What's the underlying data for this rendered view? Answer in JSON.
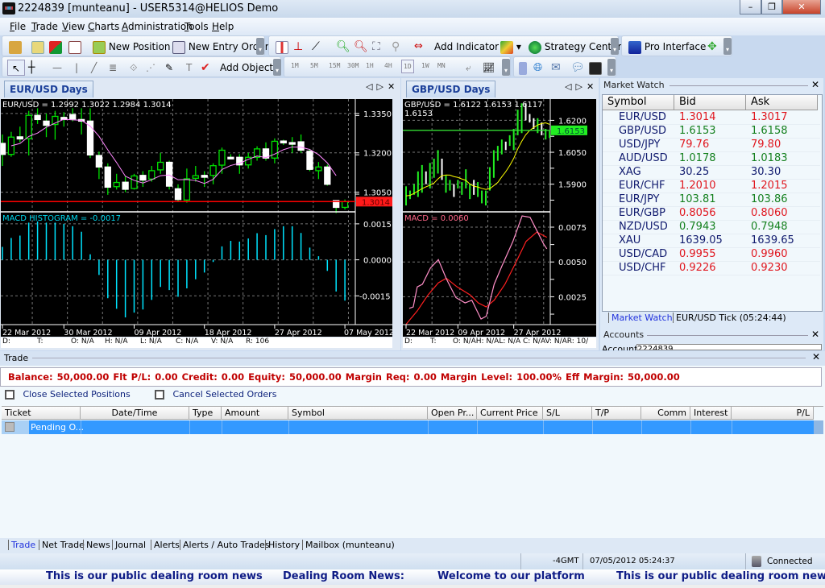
{
  "window": {
    "title": "2224839 [munteanu] - USER5314@HELIOS Demo",
    "minimize": "–",
    "maximize": "❐",
    "close": "✕"
  },
  "menu": [
    "File",
    "Trade",
    "View",
    "Charts",
    "Administration",
    "Tools",
    "Help"
  ],
  "toolbar": {
    "new_position": "New Position",
    "new_entry_order": "New Entry Order",
    "add_indicator": "Add Indicator",
    "strategy_center": "Strategy Center",
    "pro_interface": "Pro Interface",
    "add_object": "Add Object",
    "timeframes": [
      "1M",
      "5M",
      "15M",
      "30M",
      "1H",
      "4H",
      "1D",
      "1W",
      "MN"
    ],
    "active_timeframe": "1D"
  },
  "charts": [
    {
      "tab": "EUR/USD Days",
      "symbol": "EUR/USD",
      "ohlc_text": "EUR/USD = 1.2992  1.3022  1.2984  1.3014",
      "last_price": "1.3014",
      "price_ticks": [
        "1.3350",
        "1.3200",
        "1.3050"
      ],
      "indicator_label": "MACD HISTOGRAM = -0.0017",
      "indicator_ticks": [
        "0.0015",
        "0.0000",
        "-0.0015"
      ],
      "date_ticks": [
        {
          "label": "22 Mar 2012",
          "i": 0
        },
        {
          "label": "30 Mar 2012",
          "i": 7
        },
        {
          "label": "09 Apr 2012",
          "i": 15
        },
        {
          "label": "18 Apr 2012",
          "i": 23
        },
        {
          "label": "27 Apr 2012",
          "i": 31
        },
        {
          "label": "07 May 2012",
          "i": 39
        }
      ],
      "info": {
        "d": "D:",
        "t": "T:",
        "o": "O: N/A",
        "h": "H: N/A",
        "l": "L: N/A",
        "c": "C: N/A",
        "v": "V: N/A",
        "r": "R: 106"
      }
    },
    {
      "tab": "GBP/USD Days",
      "symbol": "GBP/USD",
      "ohlc_text": "GBP/USD = 1.6122  1.6153  1.6117",
      "ohlc_text2": "1.6153",
      "last_price": "1.6153",
      "price_ticks": [
        "1.6200",
        "1.6050",
        "1.5900"
      ],
      "indicator_label": "MACD = 0.0060",
      "indicator_ticks": [
        "0.0075",
        "0.0050",
        "0.0025"
      ],
      "date_ticks": [
        {
          "label": "22 Mar 2012",
          "i": 0
        },
        {
          "label": "09 Apr 2012",
          "i": 13
        },
        {
          "label": "27 Apr 2012",
          "i": 27
        }
      ],
      "info": {
        "d": "D:",
        "t": "T:",
        "rest": "O: N/AH: N/AL: N/A C: N/AV: N/AR: 10/"
      }
    }
  ],
  "chart_data": [
    {
      "type": "candlestick",
      "symbol": "EUR/USD",
      "ylim": [
        1.2975,
        1.3405
      ],
      "ticks": [
        1.335,
        1.32,
        1.305
      ],
      "last": 1.3014,
      "ohlc": [
        [
          1.3236,
          1.327,
          1.315,
          1.3194
        ],
        [
          1.3194,
          1.328,
          1.3185,
          1.326
        ],
        [
          1.3261,
          1.33,
          1.324,
          1.3253
        ],
        [
          1.3254,
          1.336,
          1.319,
          1.3343
        ],
        [
          1.3343,
          1.337,
          1.331,
          1.3327
        ],
        [
          1.3321,
          1.335,
          1.326,
          1.3305
        ],
        [
          1.3308,
          1.336,
          1.325,
          1.3339
        ],
        [
          1.3335,
          1.3355,
          1.33,
          1.3327
        ],
        [
          1.3346,
          1.337,
          1.332,
          1.3329
        ],
        [
          1.3327,
          1.337,
          1.327,
          1.3321
        ],
        [
          1.3321,
          1.337,
          1.318,
          1.3192
        ],
        [
          1.319,
          1.3205,
          1.31,
          1.3146
        ],
        [
          1.3146,
          1.316,
          1.304,
          1.3069
        ],
        [
          1.3071,
          1.312,
          1.306,
          1.3087
        ],
        [
          1.3088,
          1.311,
          1.305,
          1.3061
        ],
        [
          1.3064,
          1.312,
          1.306,
          1.3112
        ],
        [
          1.3114,
          1.313,
          1.307,
          1.3096
        ],
        [
          1.31,
          1.315,
          1.309,
          1.3132
        ],
        [
          1.3135,
          1.32,
          1.312,
          1.3164
        ],
        [
          1.3164,
          1.317,
          1.306,
          1.3073
        ],
        [
          1.3063,
          1.308,
          1.3015,
          1.3022
        ],
        [
          1.302,
          1.314,
          1.301,
          1.3101
        ],
        [
          1.3103,
          1.315,
          1.309,
          1.3113
        ],
        [
          1.3114,
          1.313,
          1.307,
          1.3107
        ],
        [
          1.3114,
          1.316,
          1.308,
          1.3151
        ],
        [
          1.3153,
          1.322,
          1.312,
          1.321
        ],
        [
          1.3183,
          1.3195,
          1.3175,
          1.3178
        ],
        [
          1.3183,
          1.3195,
          1.312,
          1.3154
        ],
        [
          1.3154,
          1.32,
          1.314,
          1.3183
        ],
        [
          1.3183,
          1.3225,
          1.317,
          1.3215
        ],
        [
          1.3215,
          1.324,
          1.317,
          1.318
        ],
        [
          1.318,
          1.3255,
          1.316,
          1.3244
        ],
        [
          1.3245,
          1.325,
          1.323,
          1.3238
        ],
        [
          1.3239,
          1.326,
          1.32,
          1.3235
        ],
        [
          1.3242,
          1.327,
          1.32,
          1.321
        ],
        [
          1.3206,
          1.3215,
          1.313,
          1.3137
        ],
        [
          1.3132,
          1.3165,
          1.31,
          1.3146
        ],
        [
          1.3146,
          1.3155,
          1.3075,
          1.308
        ],
        [
          1.3018,
          1.3018,
          1.297,
          1.2992
        ],
        [
          1.2992,
          1.3022,
          1.2984,
          1.3014
        ]
      ],
      "ma_color": "#ff88ff",
      "indicator": {
        "name": "MACD HISTOGRAM",
        "ylim": [
          -0.0027,
          0.002
        ],
        "ticks": [
          0.0015,
          0,
          -0.0015
        ],
        "color": "#00e5ff",
        "values": [
          0.00054,
          0.00091,
          0.00101,
          0.00155,
          0.0016,
          0.00155,
          0.00155,
          0.0015,
          0.0014,
          0.00117,
          0.00023,
          -0.00063,
          -0.0016,
          -0.00204,
          -0.0024,
          -0.0022,
          -0.00207,
          -0.00167,
          -0.00113,
          -0.00126,
          -0.00154,
          -0.00119,
          -0.00081,
          -0.00053,
          -9e-05,
          0.00056,
          0.00079,
          0.00076,
          0.00089,
          0.00111,
          0.00103,
          0.00128,
          0.0014,
          0.0014,
          0.00112,
          0.00051,
          0.00015,
          -0.00046,
          -0.00132,
          -0.0017
        ]
      }
    },
    {
      "type": "bars",
      "symbol": "GBP/USD",
      "ylim": [
        1.577,
        1.63
      ],
      "ticks": [
        1.62,
        1.605,
        1.59
      ],
      "last": 1.6153,
      "bars": [
        [
          1.58,
          1.589,
          "up"
        ],
        [
          1.583,
          1.587,
          "up"
        ],
        [
          1.585,
          1.59,
          "up"
        ],
        [
          1.584,
          1.596,
          "up"
        ],
        [
          1.586,
          1.599,
          "up"
        ],
        [
          1.59,
          1.596,
          "down"
        ],
        [
          1.588,
          1.6,
          "up"
        ],
        [
          1.593,
          1.602,
          "up"
        ],
        [
          1.595,
          1.606,
          "up"
        ],
        [
          1.592,
          1.602,
          "down"
        ],
        [
          1.586,
          1.594,
          "up"
        ],
        [
          1.587,
          1.592,
          "up"
        ],
        [
          1.584,
          1.59,
          "down"
        ],
        [
          1.588,
          1.592,
          "up"
        ],
        [
          1.585,
          1.591,
          "up"
        ],
        [
          1.588,
          1.597,
          "up"
        ],
        [
          1.583,
          1.59,
          "up"
        ],
        [
          1.585,
          1.592,
          "down"
        ],
        [
          1.584,
          1.591,
          "up"
        ],
        [
          1.581,
          1.587,
          "up"
        ],
        [
          1.58,
          1.587,
          "up"
        ],
        [
          1.587,
          1.598,
          "up"
        ],
        [
          1.593,
          1.606,
          "up"
        ],
        [
          1.601,
          1.608,
          "up"
        ],
        [
          1.604,
          1.611,
          "up"
        ],
        [
          1.606,
          1.61,
          "down"
        ],
        [
          1.608,
          1.613,
          "up"
        ],
        [
          1.606,
          1.616,
          "up"
        ],
        [
          1.613,
          1.625,
          "up"
        ],
        [
          1.614,
          1.628,
          "up"
        ],
        [
          1.62,
          1.628,
          "down"
        ],
        [
          1.619,
          1.623,
          "down"
        ],
        [
          1.616,
          1.621,
          "down"
        ],
        [
          1.614,
          1.621,
          "up"
        ],
        [
          1.613,
          1.619,
          "down"
        ],
        [
          1.611,
          1.616,
          "up"
        ],
        [
          1.6117,
          1.6153,
          "up"
        ]
      ],
      "ma_color": "#ffff00",
      "indicator": {
        "name": "MACD",
        "ylim": [
          0.0005,
          0.0086
        ],
        "ticks": [
          0.0075,
          0.005,
          0.0025
        ],
        "macd": {
          "color": "#ff8fc8",
          "points": [
            [
              0.8,
              0.00167
            ],
            [
              1.8,
              0.00177
            ],
            [
              2.8,
              0.00321
            ],
            [
              4.1,
              0.0034
            ],
            [
              6.1,
              0.00456
            ],
            [
              8.1,
              0.00517
            ],
            [
              10.1,
              0.00379
            ],
            [
              12.5,
              0.00244
            ],
            [
              14.8,
              0.00206
            ],
            [
              16.5,
              0.00225
            ],
            [
              18.8,
              0.0009
            ],
            [
              20.1,
              0.0011
            ],
            [
              22.1,
              0.0034
            ],
            [
              24.1,
              0.00475
            ],
            [
              26.8,
              0.00648
            ],
            [
              29.1,
              0.00831
            ],
            [
              31.1,
              0.00821
            ],
            [
              32.8,
              0.00725
            ],
            [
              34.5,
              0.00629
            ],
            [
              35.3,
              0.00594
            ]
          ]
        },
        "signal": {
          "color": "#ff2020",
          "points": [
            [
              0,
              0.00052
            ],
            [
              2.8,
              0.00148
            ],
            [
              5.5,
              0.00263
            ],
            [
              8.1,
              0.0035
            ],
            [
              10.1,
              0.00383
            ],
            [
              12.8,
              0.00321
            ],
            [
              16.1,
              0.00263
            ],
            [
              18.1,
              0.00206
            ],
            [
              20.1,
              0.00177
            ],
            [
              22.1,
              0.00225
            ],
            [
              24.8,
              0.0034
            ],
            [
              27.5,
              0.00494
            ],
            [
              30.1,
              0.00648
            ],
            [
              32.8,
              0.00715
            ],
            [
              35.3,
              0.00677
            ]
          ]
        }
      }
    }
  ],
  "market_watch": {
    "title": "Market Watch",
    "columns": [
      "Symbol",
      "Bid",
      "Ask"
    ],
    "rows": [
      {
        "symbol": "EUR/USD",
        "bid": "1.3014",
        "ask": "1.3017",
        "dir": "red"
      },
      {
        "symbol": "GBP/USD",
        "bid": "1.6153",
        "ask": "1.6158",
        "dir": "green"
      },
      {
        "symbol": "USD/JPY",
        "bid": "79.76",
        "ask": "79.80",
        "dir": "red"
      },
      {
        "symbol": "AUD/USD",
        "bid": "1.0178",
        "ask": "1.0183",
        "dir": "green"
      },
      {
        "symbol": "XAG",
        "bid": "30.25",
        "ask": "30.30",
        "dir": "navy"
      },
      {
        "symbol": "EUR/CHF",
        "bid": "1.2010",
        "ask": "1.2015",
        "dir": "red"
      },
      {
        "symbol": "EUR/JPY",
        "bid": "103.81",
        "ask": "103.86",
        "dir": "green"
      },
      {
        "symbol": "EUR/GBP",
        "bid": "0.8056",
        "ask": "0.8060",
        "dir": "red"
      },
      {
        "symbol": "NZD/USD",
        "bid": "0.7943",
        "ask": "0.7948",
        "dir": "green"
      },
      {
        "symbol": "XAU",
        "bid": "1639.05",
        "ask": "1639.65",
        "dir": "navy"
      },
      {
        "symbol": "USD/CAD",
        "bid": "0.9955",
        "ask": "0.9960",
        "dir": "red"
      },
      {
        "symbol": "USD/CHF",
        "bid": "0.9226",
        "ask": "0.9230",
        "dir": "red"
      }
    ],
    "tabs": [
      "Market Watch",
      "EUR/USD Tick (05:24:44)"
    ]
  },
  "accounts": {
    "title": "Accounts",
    "label": "Account",
    "value": "2224839"
  },
  "trade": {
    "title": "Trade",
    "summary": "Balance: 50,000.00  Flt P/L: 0.00  Credit: 0.00  Equity: 50,000.00  Margin Req: 0.00  Margin Level: 100.00%  Eff Margin: 50,000.00",
    "close_selected": "Close Selected Positions",
    "cancel_selected": "Cancel Selected Orders",
    "columns": [
      "Ticket",
      "Date/Time",
      "Type",
      "Amount",
      "Symbol",
      "Open Pr...",
      "Current Price",
      "S/L",
      "T/P",
      "Comm",
      "Interest",
      "P/L"
    ],
    "rows": [
      {
        "ticket": "Pending O..."
      }
    ]
  },
  "bottom_tabs": [
    "Trade",
    "Net Trade",
    "News",
    "Journal",
    "Alerts",
    "Alerts / Auto Trades",
    "History",
    "Mailbox (munteanu)"
  ],
  "status": {
    "timezone": "-4GMT",
    "datetime": "07/05/2012 05:24:37",
    "connection": "Connected"
  },
  "ticker": [
    "This is our public dealing room news",
    "Dealing Room News:",
    "Welcome to our platform",
    "This is our public dealing room news"
  ],
  "colors": {
    "selected_row": "#3399ff",
    "summary_text": "#c00000",
    "up_candle": "#00e000",
    "ticker_text": "#0f1c86"
  }
}
